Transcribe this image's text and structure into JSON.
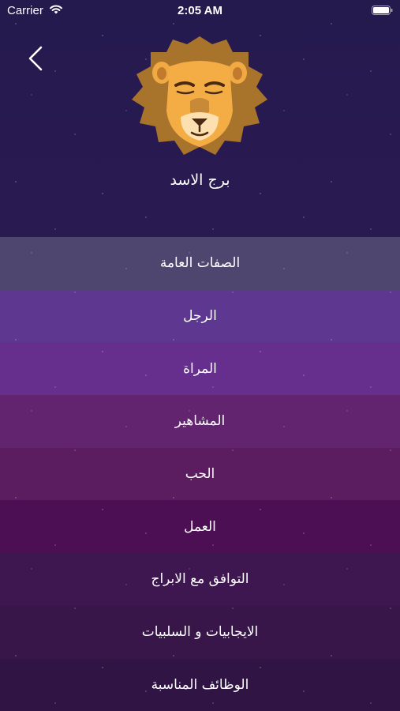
{
  "status_bar": {
    "carrier": "Carrier",
    "time": "2:05 AM"
  },
  "header": {
    "back_icon": "chevron-left-icon",
    "sign_icon": "lion-icon",
    "title": "برج الاسد"
  },
  "menu": {
    "items": [
      {
        "label": "الصفات العامة",
        "color": "#4f4670"
      },
      {
        "label": "الرجل",
        "color": "#5d3790"
      },
      {
        "label": "المراة",
        "color": "#662f8d"
      },
      {
        "label": "المشاهير",
        "color": "#63246f"
      },
      {
        "label": "الحب",
        "color": "#5c1c60"
      },
      {
        "label": "العمل",
        "color": "#4d0f54"
      },
      {
        "label": "التوافق مع الابراج",
        "color": "#3f1750"
      },
      {
        "label": "الايجابيات و السلبيات",
        "color": "#38164a"
      },
      {
        "label": "الوظائف المناسبة",
        "color": "#301544"
      }
    ]
  }
}
